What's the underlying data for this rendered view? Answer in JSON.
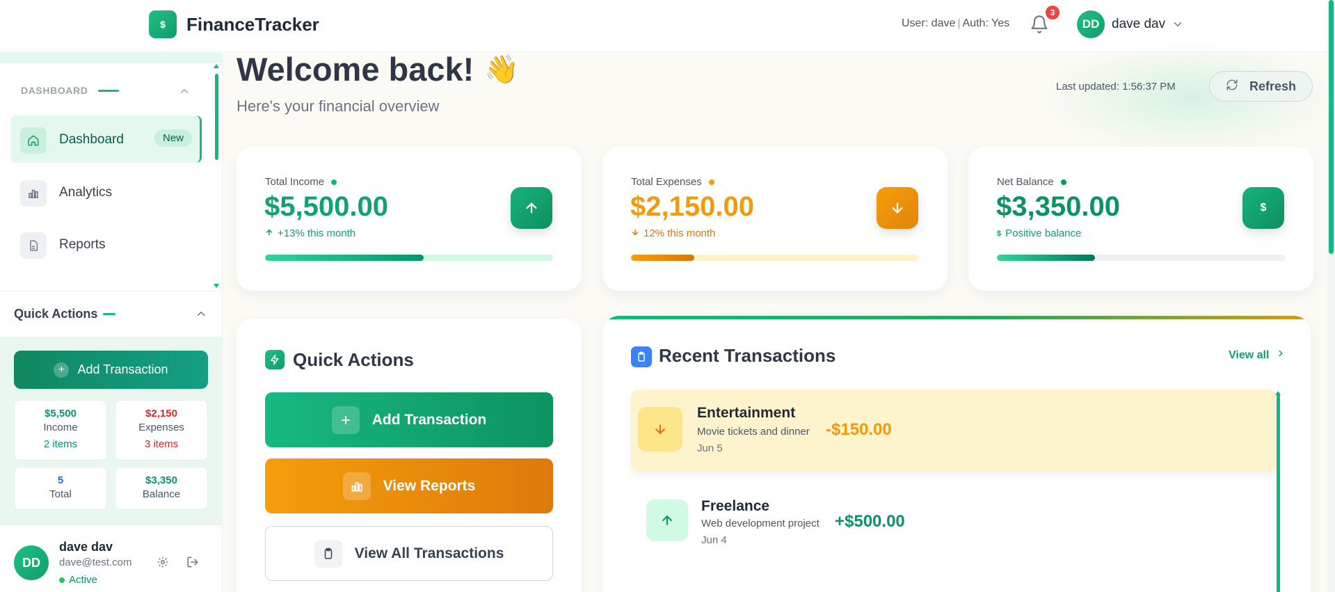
{
  "header": {
    "logo_symbol": "$",
    "app_title": "FinanceTracker",
    "user_status": "User: dave",
    "auth_status": "Auth: Yes",
    "notification_count": "3",
    "avatar_initials": "DD",
    "user_name": "dave dav"
  },
  "sidebar": {
    "section_title": "DASHBOARD",
    "nav_items": [
      {
        "label": "Dashboard",
        "icon": "home-icon",
        "badge": "New",
        "active": true
      },
      {
        "label": "Analytics",
        "icon": "bar-chart-icon",
        "active": false
      },
      {
        "label": "Reports",
        "icon": "document-icon",
        "active": false
      }
    ],
    "quick_actions": {
      "title": "Quick Actions",
      "add_button": "Add Transaction",
      "stats": [
        {
          "value": "$5,500",
          "label": "Income",
          "sub": "2 items"
        },
        {
          "value": "$2,150",
          "label": "Expenses",
          "sub": "3 items"
        },
        {
          "value": "5",
          "label": "Total"
        },
        {
          "value": "$3,350",
          "label": "Balance"
        }
      ]
    },
    "profile": {
      "initials": "DD",
      "name": "dave dav",
      "email": "dave@test.com",
      "status": "Active"
    }
  },
  "main": {
    "welcome": "Welcome back!",
    "wave_emoji": "👋",
    "subtitle": "Here's your financial overview",
    "last_updated": "Last updated: 1:56:37 PM",
    "refresh_label": "Refresh",
    "stat_cards": [
      {
        "label": "Total Income",
        "value": "$5,500.00",
        "sub": "+13% this month",
        "progress": 0.55,
        "color": "#10b981"
      },
      {
        "label": "Total Expenses",
        "value": "$2,150.00",
        "sub": "12% this month",
        "progress": 0.22,
        "color": "#f59e0b"
      },
      {
        "label": "Net Balance",
        "value": "$3,350.00",
        "sub": "Positive balance",
        "progress": 0.34,
        "color": "#059669"
      }
    ],
    "quick_actions": {
      "title": "Quick Actions",
      "add": "Add Transaction",
      "reports": "View Reports",
      "all": "View All Transactions"
    },
    "recent_transactions": {
      "title": "Recent Transactions",
      "view_all": "View all",
      "items": [
        {
          "name": "Entertainment",
          "description": "Movie tickets and dinner",
          "amount": "-$150.00",
          "date": "Jun 5",
          "type": "expense"
        },
        {
          "name": "Freelance",
          "description": "Web development project",
          "amount": "+$500.00",
          "date": "Jun 4",
          "type": "income"
        }
      ]
    }
  },
  "colors": {
    "brand": "#10b981",
    "income": "#059669",
    "expense": "#f59e0b",
    "expense_red": "#dc2626",
    "notification": "#ef4444",
    "info": "#3b82f6"
  }
}
